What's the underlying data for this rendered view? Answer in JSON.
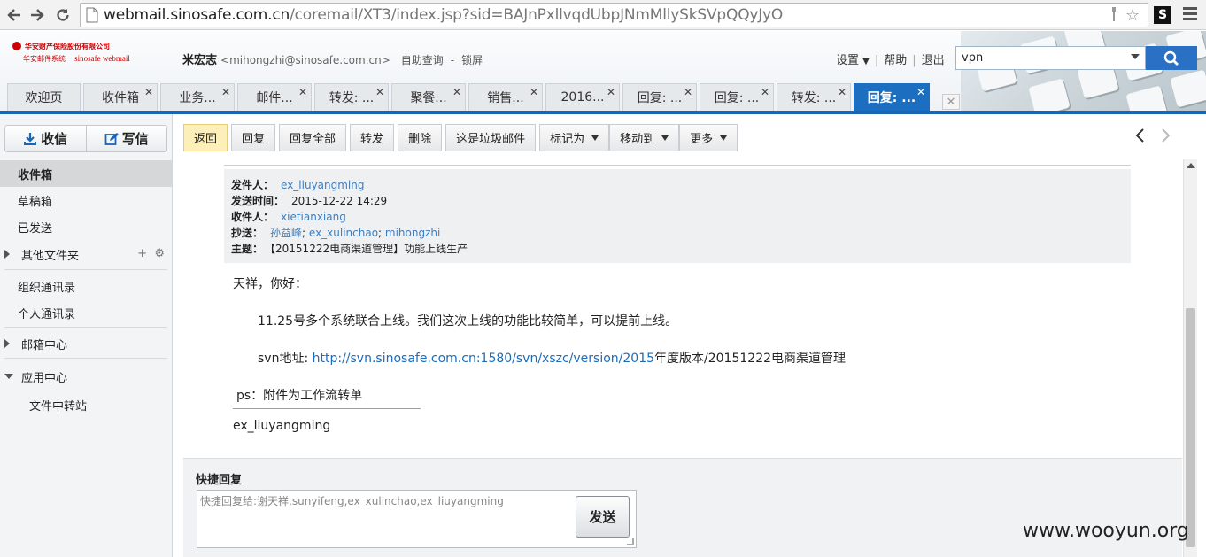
{
  "browser": {
    "url_host": "webmail.sinosafe.com.cn",
    "url_path": "/coremail/XT3/index.jsp?sid=BAJnPxllvqdUbpJNmMllySkSVpQQyJyO",
    "extension_label": "S"
  },
  "header": {
    "logo_line1": "华安财产保险股份有限公司",
    "logo_line2": "华安邮件系统",
    "logo_line3": "sinosafe webmail",
    "user_name": "米宏志",
    "user_email": "<mihongzhi@sinosafe.com.cn>",
    "self_query": "自助查询",
    "lock_screen": "锁屏",
    "link_sep": "-",
    "settings": "设置",
    "help": "帮助",
    "logout": "退出",
    "search_value": "vpn"
  },
  "tabs": [
    {
      "label": "欢迎页",
      "closable": false
    },
    {
      "label": "收件箱",
      "closable": true
    },
    {
      "label": "业务...",
      "closable": true
    },
    {
      "label": "邮件...",
      "closable": true
    },
    {
      "label": "转发: ...",
      "closable": true
    },
    {
      "label": "聚餐...",
      "closable": true
    },
    {
      "label": "销售...",
      "closable": true
    },
    {
      "label": "2016...",
      "closable": true
    },
    {
      "label": "回复: ...",
      "closable": true
    },
    {
      "label": "回复: ...",
      "closable": true
    },
    {
      "label": "转发: ...",
      "closable": true
    },
    {
      "label": "回复: ...",
      "closable": true,
      "active": true
    }
  ],
  "sidebar": {
    "receive": "收信",
    "compose": "写信",
    "items": {
      "inbox": "收件箱",
      "drafts": "草稿箱",
      "sent": "已发送",
      "other_folders": "其他文件夹",
      "org_contacts": "组织通讯录",
      "personal_contacts": "个人通讯录",
      "mail_center": "邮箱中心",
      "app_center": "应用中心",
      "file_transfer": "文件中转站"
    }
  },
  "toolbar": {
    "back": "返回",
    "reply": "回复",
    "reply_all": "回复全部",
    "forward": "转发",
    "delete": "删除",
    "spam": "这是垃圾邮件",
    "mark_as": "标记为",
    "move_to": "移动到",
    "more": "更多"
  },
  "mail": {
    "labels": {
      "from": "发件人：",
      "time": "发送时间：",
      "to": "收件人：",
      "cc": "抄送：",
      "subject": "主题："
    },
    "from": "ex_liuyangming",
    "time": "2015-12-22 14:29",
    "to": "xietianxiang",
    "cc": [
      "孙益峰",
      "ex_xulinchao",
      "mihongzhi"
    ],
    "cc_sep": "; ",
    "subject": "【20151222电商渠道管理】功能上线生产",
    "greeting": "天祥，你好：",
    "line1": "11.25号多个系统联合上线。我们这次上线的功能比较简单，可以提前上线。",
    "svn_prefix": "svn地址: ",
    "svn_link": "http://svn.sinosafe.com.cn:1580/svn/xszc/version/2015",
    "svn_suffix": "年度版本/20151222电商渠道管理",
    "ps": "ps：附件为工作流转单",
    "signature": "ex_liuyangming"
  },
  "quick_reply": {
    "title": "快捷回复",
    "placeholder": "快捷回复给:谢天祥,sunyifeng,ex_xulinchao,ex_liuyangming",
    "send": "发送"
  },
  "watermark": "www.wooyun.org",
  "colors": {
    "accent_blue": "#1a66b4",
    "link_blue": "#1d6cb8",
    "active_tab": "#1c6fc0",
    "primary_button": "#fcefb9"
  }
}
